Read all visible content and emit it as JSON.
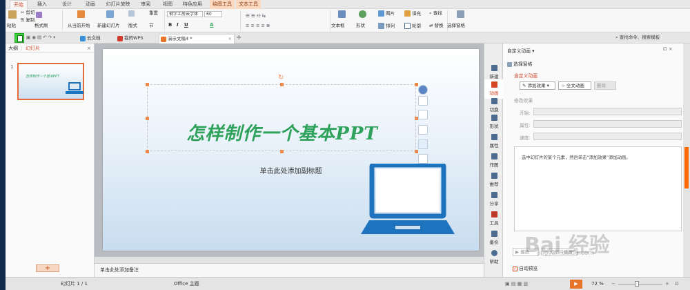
{
  "menu": {
    "tabs": [
      "开始",
      "插入",
      "设计",
      "动画",
      "幻灯片放映",
      "审阅",
      "视图",
      "特色应用",
      "绘图工具",
      "文本工具"
    ],
    "active": "开始"
  },
  "ribbon": {
    "paste": "粘贴",
    "cut": "剪切",
    "copy": "复制",
    "format_painter": "格式刷",
    "from_current": "从当前开始",
    "new_slide": "新建幻灯片",
    "layout": "版式",
    "section": "节",
    "reset": "重置",
    "font_name": "钢字工房云字体",
    "font_size": "60",
    "text_box": "文本框",
    "shape": "形状",
    "picture": "图片",
    "fill": "填充",
    "arrange": "排列",
    "outline": "轮廓",
    "find": "查找",
    "replace": "替换",
    "select_pane": "选择窗格",
    "fmt_bold": "B",
    "fmt_italic": "I",
    "fmt_underline": "U",
    "fmt_color": "A"
  },
  "doc_tabs": {
    "cloud": "云文档",
    "mywps": "我的WPS",
    "current": "演示文稿4 *",
    "add": "+",
    "search_hint": "查找命令、搜索模板"
  },
  "left_panel": {
    "tab_outline": "大纲",
    "tab_slides": "幻灯片",
    "slide_number": "1",
    "add_label": "+"
  },
  "slide": {
    "title": "怎样制作一个基本PPT",
    "subtitle": "单击此处添加副标题"
  },
  "notes": "单击此处添加备注",
  "vstrip": [
    "新建",
    "动画",
    "切换",
    "形状",
    "属性",
    "作图",
    "推荐",
    "分享",
    "工具",
    "备份",
    "帮助"
  ],
  "pane": {
    "header": "自定义动画",
    "select_pane": "选择窗格",
    "section_title": "自定义动画",
    "add_effect": "添加效果",
    "full_text_anim": "全文动画",
    "delete": "删除",
    "modify": "修改效果",
    "start_label": "开始:",
    "prop_label": "属性:",
    "speed_label": "速度:",
    "hint": "选中幻灯片的某个元素，然后单击“添加效果”添加动画。",
    "play": "播放",
    "slideshow": "幻灯片播放",
    "autopreview": "自动预览"
  },
  "status": {
    "slide_info": "幻灯片 1 / 1",
    "theme": "Office 主题",
    "zoom": "72 %"
  },
  "watermark": {
    "text": "Bai 经验",
    "url": "jingyan.baidu.com"
  },
  "colors": {
    "accent": "#d24726",
    "title_green": "#2ea25a",
    "laptop_blue": "#1e73be",
    "highlight_green": "#3ed13e"
  }
}
